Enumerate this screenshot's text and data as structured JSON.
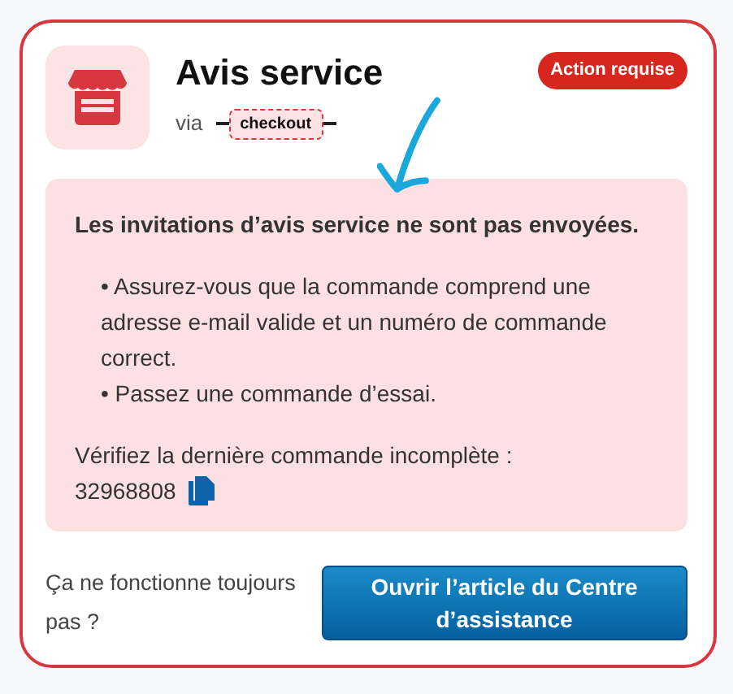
{
  "card": {
    "title": "Avis service",
    "via_label": "via",
    "source_tag": "checkout",
    "status_badge": "Action requise",
    "alert": {
      "heading": "Les invitations d’avis service ne sont pas envoyées.",
      "items": [
        "• Assurez-vous que la commande comprend une adresse e-mail valide et un numéro de commande correct.",
        "• Passez une commande d’essai."
      ],
      "check_label": "Vérifiez la dernière commande incomplète :",
      "order_number": "32968808"
    },
    "footer_text": "Ça ne fonctionne toujours pas ?",
    "help_button": "Ouvrir l’article du Centre d’assistance"
  }
}
